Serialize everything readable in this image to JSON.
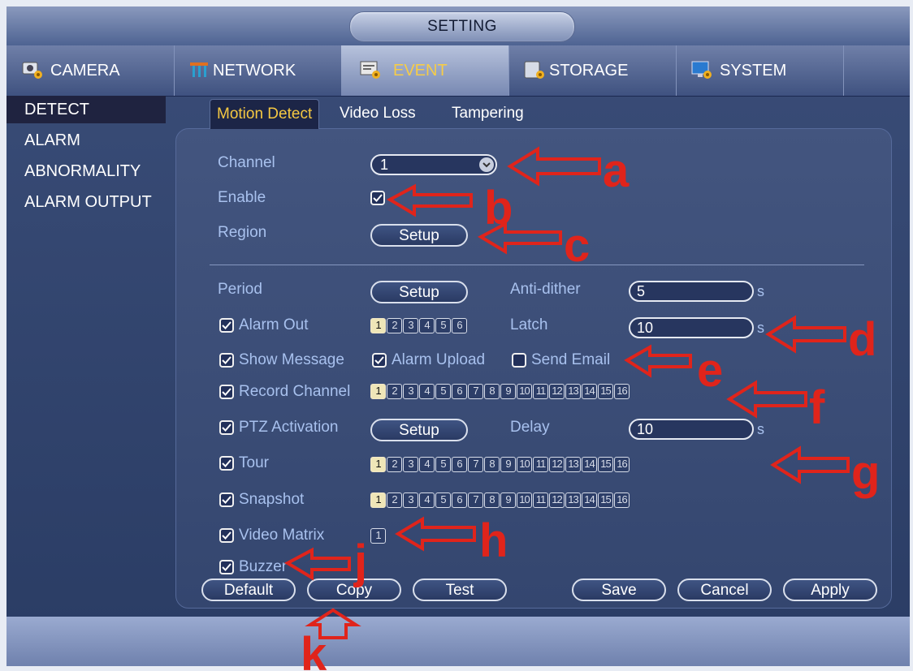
{
  "window": {
    "title": "SETTING"
  },
  "main_tabs": [
    {
      "label": "CAMERA",
      "icon": "camera-icon"
    },
    {
      "label": "NETWORK",
      "icon": "network-icon"
    },
    {
      "label": "EVENT",
      "icon": "event-icon"
    },
    {
      "label": "STORAGE",
      "icon": "storage-icon"
    },
    {
      "label": "SYSTEM",
      "icon": "system-icon"
    }
  ],
  "active_main_tab": "EVENT",
  "sidebar": {
    "items": [
      {
        "label": "DETECT"
      },
      {
        "label": "ALARM"
      },
      {
        "label": "ABNORMALITY"
      },
      {
        "label": "ALARM OUTPUT"
      }
    ],
    "active": "DETECT"
  },
  "sub_tabs": [
    {
      "label": "Motion Detect"
    },
    {
      "label": "Video Loss"
    },
    {
      "label": "Tampering"
    }
  ],
  "form": {
    "channel": {
      "label": "Channel",
      "value": "1"
    },
    "enable": {
      "label": "Enable",
      "checked": true
    },
    "region": {
      "label": "Region",
      "button": "Setup"
    },
    "period": {
      "label": "Period",
      "button": "Setup"
    },
    "anti_dither": {
      "label": "Anti-dither",
      "value": "5",
      "unit": "s"
    },
    "alarm_out": {
      "label": "Alarm Out",
      "checked": true,
      "channels": [
        "1",
        "2",
        "3",
        "4",
        "5",
        "6"
      ],
      "selected": [
        "1"
      ]
    },
    "latch": {
      "label": "Latch",
      "value": "10",
      "unit": "s"
    },
    "show_message": {
      "label": "Show Message",
      "checked": true
    },
    "alarm_upload": {
      "label": "Alarm Upload",
      "checked": true
    },
    "send_email": {
      "label": "Send Email",
      "checked": false
    },
    "record_channel": {
      "label": "Record Channel",
      "checked": true,
      "channels": [
        "1",
        "2",
        "3",
        "4",
        "5",
        "6",
        "7",
        "8",
        "9",
        "10",
        "11",
        "12",
        "13",
        "14",
        "15",
        "16"
      ],
      "selected": [
        "1"
      ]
    },
    "ptz_activation": {
      "label": "PTZ Activation",
      "checked": true,
      "button": "Setup"
    },
    "delay": {
      "label": "Delay",
      "value": "10",
      "unit": "s"
    },
    "tour": {
      "label": "Tour",
      "checked": true,
      "channels": [
        "1",
        "2",
        "3",
        "4",
        "5",
        "6",
        "7",
        "8",
        "9",
        "10",
        "11",
        "12",
        "13",
        "14",
        "15",
        "16"
      ],
      "selected": [
        "1"
      ]
    },
    "snapshot": {
      "label": "Snapshot",
      "checked": true,
      "channels": [
        "1",
        "2",
        "3",
        "4",
        "5",
        "6",
        "7",
        "8",
        "9",
        "10",
        "11",
        "12",
        "13",
        "14",
        "15",
        "16"
      ],
      "selected": [
        "1"
      ]
    },
    "video_matrix": {
      "label": "Video Matrix",
      "checked": true,
      "channels": [
        "1"
      ],
      "selected": []
    },
    "buzzer": {
      "label": "Buzzer",
      "checked": true
    }
  },
  "buttons": {
    "default": "Default",
    "copy": "Copy",
    "test": "Test",
    "save": "Save",
    "cancel": "Cancel",
    "apply": "Apply"
  },
  "annotations": [
    "a",
    "b",
    "c",
    "d",
    "e",
    "f",
    "g",
    "h",
    "j",
    "k"
  ],
  "colors": {
    "annotation": "#e0241b",
    "active_label": "#f5c842",
    "field_label": "#a8c1ee"
  }
}
